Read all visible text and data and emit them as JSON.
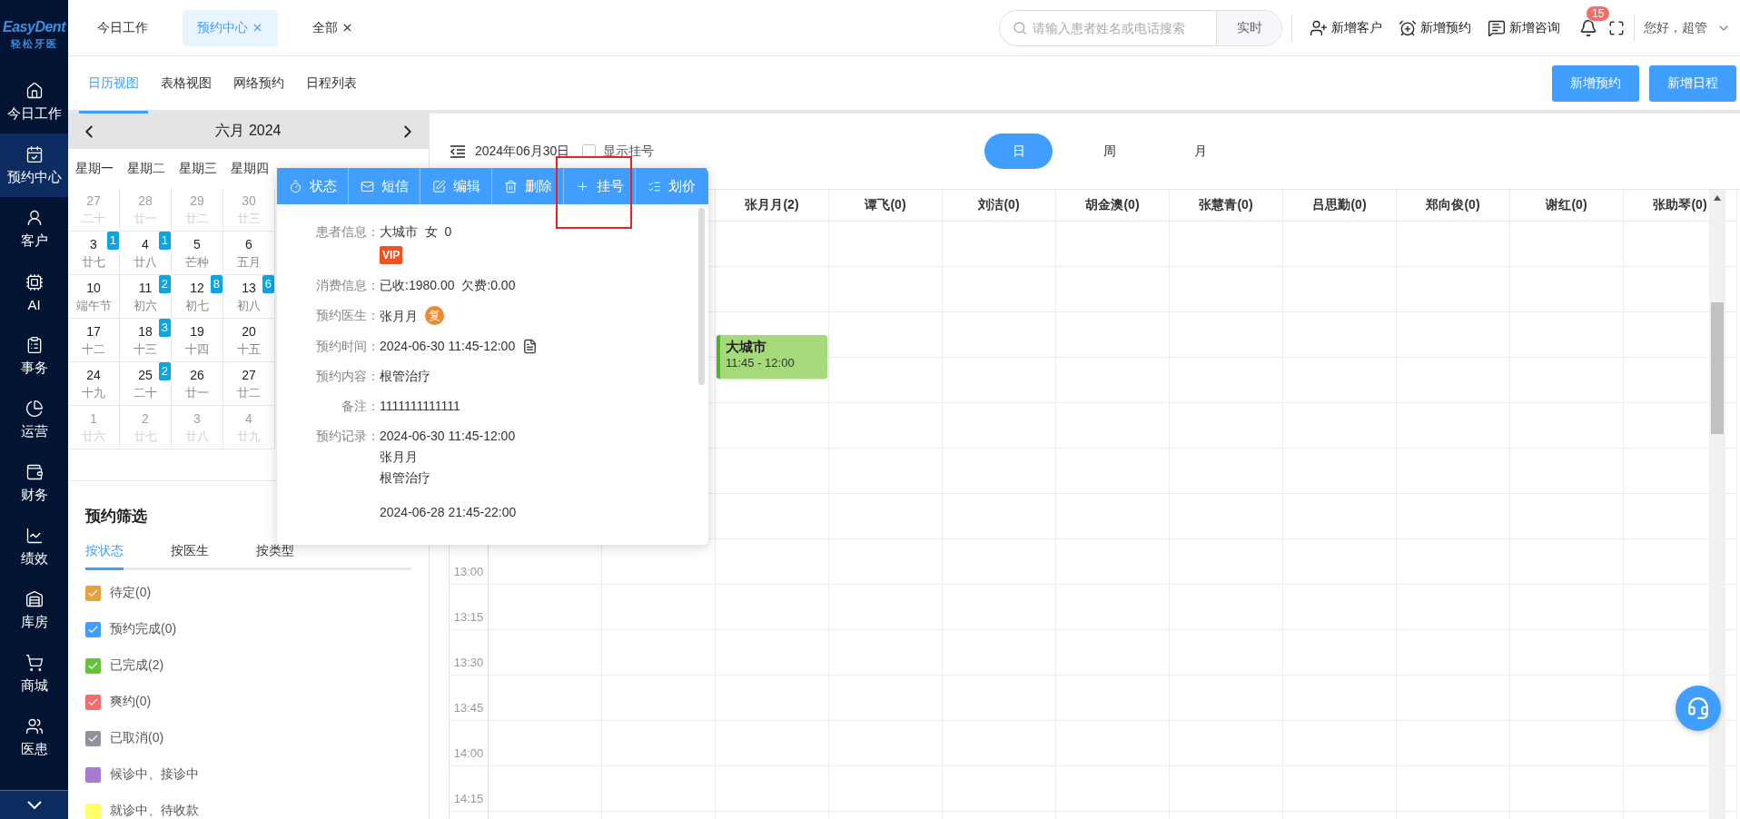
{
  "logo": {
    "name": "EasyDent",
    "subtitle": "轻松牙医"
  },
  "nav": [
    {
      "label": "今日工作",
      "selected": false
    },
    {
      "label": "预约中心",
      "selected": true
    },
    {
      "label": "客户",
      "selected": false
    },
    {
      "label": "AI",
      "selected": false
    },
    {
      "label": "事务",
      "selected": false
    },
    {
      "label": "运营",
      "selected": false
    },
    {
      "label": "财务",
      "selected": false
    },
    {
      "label": "绩效",
      "selected": false
    },
    {
      "label": "库房",
      "selected": false
    },
    {
      "label": "商城",
      "selected": false
    },
    {
      "label": "医患",
      "selected": false
    }
  ],
  "top_tabs": [
    {
      "label": "今日工作",
      "closable": false,
      "selected": false
    },
    {
      "label": "预约中心",
      "closable": true,
      "selected": true
    },
    {
      "label": "全部",
      "closable": true,
      "selected": false
    }
  ],
  "search": {
    "placeholder": "请输入患者姓名或电话搜索",
    "button": "实时"
  },
  "actions": [
    "新增客户",
    "新增预约",
    "新增咨询"
  ],
  "notifications": {
    "count": "15"
  },
  "user": {
    "greeting": "您好，超管"
  },
  "view_tabs": [
    {
      "label": "日历视图",
      "selected": true
    },
    {
      "label": "表格视图",
      "selected": false
    },
    {
      "label": "网络预约",
      "selected": false
    },
    {
      "label": "日程列表",
      "selected": false
    }
  ],
  "header_buttons": [
    "新增预约",
    "新增日程"
  ],
  "mini_calendar": {
    "title": "六月 2024",
    "weekdays": [
      "星期一",
      "星期二",
      "星期三",
      "星期四"
    ],
    "weeks": [
      [
        {
          "day": "27",
          "lunar": "二十",
          "other_month": true
        },
        {
          "day": "28",
          "lunar": "廿一",
          "other_month": true
        },
        {
          "day": "29",
          "lunar": "廿二",
          "other_month": true
        },
        {
          "day": "30",
          "lunar": "廿三",
          "other_month": true
        }
      ],
      [
        {
          "day": "3",
          "lunar": "廿七",
          "other_month": false,
          "count": "1"
        },
        {
          "day": "4",
          "lunar": "廿八",
          "other_month": false,
          "count": "1"
        },
        {
          "day": "5",
          "lunar": "芒种",
          "other_month": false
        },
        {
          "day": "6",
          "lunar": "五月",
          "other_month": false
        }
      ],
      [
        {
          "day": "10",
          "lunar": "端午节",
          "other_month": false
        },
        {
          "day": "11",
          "lunar": "初六",
          "other_month": false,
          "count": "2"
        },
        {
          "day": "12",
          "lunar": "初七",
          "other_month": false,
          "count": "8"
        },
        {
          "day": "13",
          "lunar": "初八",
          "other_month": false,
          "count": "6"
        }
      ],
      [
        {
          "day": "17",
          "lunar": "十二",
          "other_month": false
        },
        {
          "day": "18",
          "lunar": "十三",
          "other_month": false,
          "count": "3"
        },
        {
          "day": "19",
          "lunar": "十四",
          "other_month": false
        },
        {
          "day": "20",
          "lunar": "十五",
          "other_month": false
        }
      ],
      [
        {
          "day": "24",
          "lunar": "十九",
          "other_month": false
        },
        {
          "day": "25",
          "lunar": "二十",
          "other_month": false,
          "count": "2"
        },
        {
          "day": "26",
          "lunar": "廿一",
          "other_month": false
        },
        {
          "day": "27",
          "lunar": "廿二",
          "other_month": false
        }
      ],
      [
        {
          "day": "1",
          "lunar": "廿六",
          "other_month": true
        },
        {
          "day": "2",
          "lunar": "廿七",
          "other_month": true
        },
        {
          "day": "3",
          "lunar": "廿八",
          "other_month": true
        },
        {
          "day": "4",
          "lunar": "廿九",
          "other_month": true
        }
      ]
    ]
  },
  "filter": {
    "title": "预约筛选",
    "tabs": [
      {
        "label": "按状态",
        "selected": true
      },
      {
        "label": "按医生",
        "selected": false
      },
      {
        "label": "按类型",
        "selected": false
      }
    ],
    "items": [
      {
        "label": "待定(0)",
        "color": "#e6a23c",
        "checked": true
      },
      {
        "label": "预约完成(0)",
        "color": "#409eff",
        "checked": true
      },
      {
        "label": "已完成(2)",
        "color": "#67c23a",
        "checked": true
      },
      {
        "label": "爽约(0)",
        "color": "#f56c6c",
        "checked": true
      },
      {
        "label": "已取消(0)",
        "color": "#909399",
        "checked": true
      },
      {
        "label": "候诊中、接诊中",
        "color": "#a87bd1",
        "checked": false
      },
      {
        "label": "就诊中、待收款",
        "color": "#ffff66",
        "checked": false
      }
    ]
  },
  "toolbar": {
    "date": "2024年06月30日",
    "show_registration": {
      "label": "显示挂号",
      "checked": false
    },
    "modes": [
      {
        "label": "日",
        "selected": true
      },
      {
        "label": "周",
        "selected": false
      },
      {
        "label": "月",
        "selected": false
      }
    ]
  },
  "schedule": {
    "columns": [
      {},
      {},
      {
        "name": "张月月(2)",
        "events": [
          {
            "title": "大城市",
            "time": "11:45 - 12:00",
            "color": "#a6d97a"
          }
        ]
      },
      {
        "name": "谭飞(0)"
      },
      {
        "name": "刘洁(0)"
      },
      {
        "name": "胡金澳(0)"
      },
      {
        "name": "张慧青(0)"
      },
      {
        "name": "吕思勤(0)"
      },
      {
        "name": "郑向俊(0)"
      },
      {
        "name": "谢红(0)"
      },
      {
        "name": "张助琴(0)"
      }
    ],
    "rows": [
      {},
      {},
      {},
      {},
      {},
      {},
      {},
      {
        "time": "13:00"
      },
      {
        "time": "13:15"
      },
      {
        "time": "13:30"
      },
      {
        "time": "13:45"
      },
      {
        "time": "14:00"
      },
      {
        "time": "14:15"
      }
    ]
  },
  "popup": {
    "actions": [
      {
        "label": "状态",
        "highlighted": false
      },
      {
        "label": "短信",
        "highlighted": false
      },
      {
        "label": "编辑",
        "highlighted": false
      },
      {
        "label": "删除",
        "highlighted": false
      },
      {
        "label": "挂号",
        "highlighted": true
      },
      {
        "label": "划价",
        "highlighted": false
      }
    ],
    "fields": [
      {
        "label": "患者信息：",
        "value": "大城市  女  0",
        "tag": "VIP"
      },
      {
        "label": "消费信息：",
        "value": "已收:1980.00  欠费:0.00"
      },
      {
        "label": "预约医生：",
        "value": "张月月",
        "badge": "复"
      },
      {
        "label": "预约时间：",
        "value": "2024-06-30 11:45-12:00",
        "attachment": true
      },
      {
        "label": "预约内容：",
        "value": "根管治疗"
      },
      {
        "label": "备注：",
        "value": "1111111111111"
      }
    ],
    "records": {
      "label": "预约记录：",
      "entries": [
        {
          "lines": [
            "2024-06-30 11:45-12:00",
            "张月月",
            "根管治疗"
          ]
        },
        {
          "lines": [
            "2024-06-28 21:45-22:00"
          ]
        }
      ]
    }
  }
}
